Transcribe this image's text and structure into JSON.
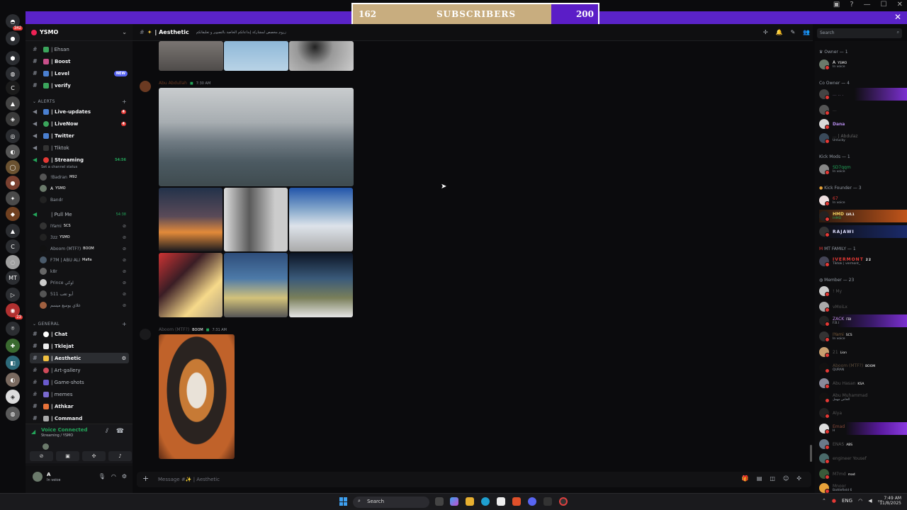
{
  "subscriber_bar": {
    "current": "162",
    "label": "SUBSCRIBERS",
    "goal": "200",
    "progress": 0.81
  },
  "server": {
    "name": "YSMO"
  },
  "guild_badges": {
    "top": "342",
    "a": "1",
    "b": "23"
  },
  "channels_top": [
    {
      "label": "| Ehsan"
    },
    {
      "label": "| Boost"
    },
    {
      "label": "| Level",
      "badge": "NEW"
    },
    {
      "label": "| verify"
    }
  ],
  "alerts": {
    "category": "ALERTS",
    "items": [
      {
        "label": "| Live-updates",
        "badge": "4"
      },
      {
        "label": "| LiveNow",
        "badge": "4"
      },
      {
        "label": "| Twitter"
      },
      {
        "label": "| Tiktok"
      }
    ]
  },
  "streaming": {
    "label": "| Streaming",
    "time": "54:56",
    "status": "Set a channel status",
    "users": [
      {
        "name": "!Badran",
        "tag": "M92"
      },
      {
        "name": "A",
        "tag": "YSMO"
      },
      {
        "name": "Bandr"
      }
    ]
  },
  "pullme": {
    "label": "| Pull Me",
    "time": "54:38",
    "users": [
      {
        "name": "IYami",
        "tag": "SCS"
      },
      {
        "name": "3zz",
        "tag": "YSMO"
      },
      {
        "name": "Aboom (MTF?)",
        "tag": "BOOM"
      },
      {
        "name": "F7M | ABU ALI",
        "tag": "Mafia"
      },
      {
        "name": "k8r"
      },
      {
        "name": "Prince اوكي"
      },
      {
        "name": "511 أبو تعب"
      },
      {
        "name": "غلاي يوسع ميسم"
      }
    ]
  },
  "general": {
    "category": "GENERAL",
    "items": [
      {
        "label": "| Chat"
      },
      {
        "label": "| Tklejat"
      },
      {
        "label": "| Aesthetic"
      },
      {
        "label": "| Art-gallery"
      },
      {
        "label": "| Game-shots"
      },
      {
        "label": "| memes"
      },
      {
        "label": "| Athkar"
      },
      {
        "label": "| Command"
      }
    ]
  },
  "voice": {
    "title": "Voice Connected",
    "sub": "Streaming / YSMO"
  },
  "user": {
    "name": "A",
    "status": "In voice"
  },
  "header": {
    "channel": "| Aesthetic",
    "topic": "زروم مخصص لمشاركة إبداعاتكم الخاصة بالتصوير و تعليقاتكم"
  },
  "search": {
    "placeholder": "Search"
  },
  "messages": [
    {
      "author": "Abu Abdullah",
      "time": "7:30 AM"
    },
    {
      "author": "Aboom (MTF?)",
      "badge": "BOOM",
      "time": "7:31 AM"
    }
  ],
  "composer": {
    "placeholder": "Message #✨ | Aesthetic"
  },
  "members": {
    "owner": {
      "header": "Owner — 1",
      "items": [
        {
          "name": "A",
          "tag": "YSMO",
          "status": "In voice"
        }
      ]
    },
    "coowner": {
      "header": "Co Owner — 4",
      "items": [
        {
          "name": "... .. ."
        },
        {
          "name": "..."
        },
        {
          "name": "Dana"
        },
        {
          "name": "... | Abdulaz",
          "status": "Unlucky"
        }
      ]
    },
    "kickmods": {
      "header": "Kick Mods — 1",
      "items": [
        {
          "name": "SD7qqm",
          "status": "In voice"
        }
      ]
    },
    "kickfounder": {
      "header": "Kick Founder — 3",
      "items": [
        {
          "name": "67",
          "status": "In voice"
        },
        {
          "name": "HMD",
          "tag": "LVL1",
          "status": "IHMD"
        },
        {
          "name": "RAJAWI"
        }
      ]
    },
    "mtfamily": {
      "header": "MT FAMILY — 1",
      "items": [
        {
          "name": "IVERMONT",
          "tag": "22",
          "status": "Tiktok | vermont_"
        }
      ]
    },
    "member": {
      "header": "Member — 23",
      "items": [
        {
          "name": "! My"
        },
        {
          "name": "vMoiLx"
        },
        {
          "name": "ZACK",
          "tag": "FBI",
          "status": "F.B.I"
        },
        {
          "name": "IYami",
          "tag": "SCS",
          "status": "In voice"
        },
        {
          "name": "21",
          "tag": "Lion"
        },
        {
          "name": "Aboom (MTF?)",
          "tag": "BOOM",
          "status": "QURAN"
        },
        {
          "name": "Abu Hasan",
          "tag": "KSA"
        },
        {
          "name": "Abu Muhammad",
          "status": "الخاص مهمل"
        },
        {
          "name": "Alya"
        },
        {
          "name": "Emad",
          "status": "H"
        },
        {
          "name": "ENAS",
          "tag": "ABS"
        },
        {
          "name": "engineer Yousef"
        },
        {
          "name": "M7md",
          "tag": "mad"
        },
        {
          "name": "Mnoor",
          "status": "Battlefield 6"
        }
      ]
    }
  },
  "taskbar": {
    "search": "Search",
    "lang": "ENG",
    "time": "7:49 AM",
    "date": "11/8/2025"
  }
}
